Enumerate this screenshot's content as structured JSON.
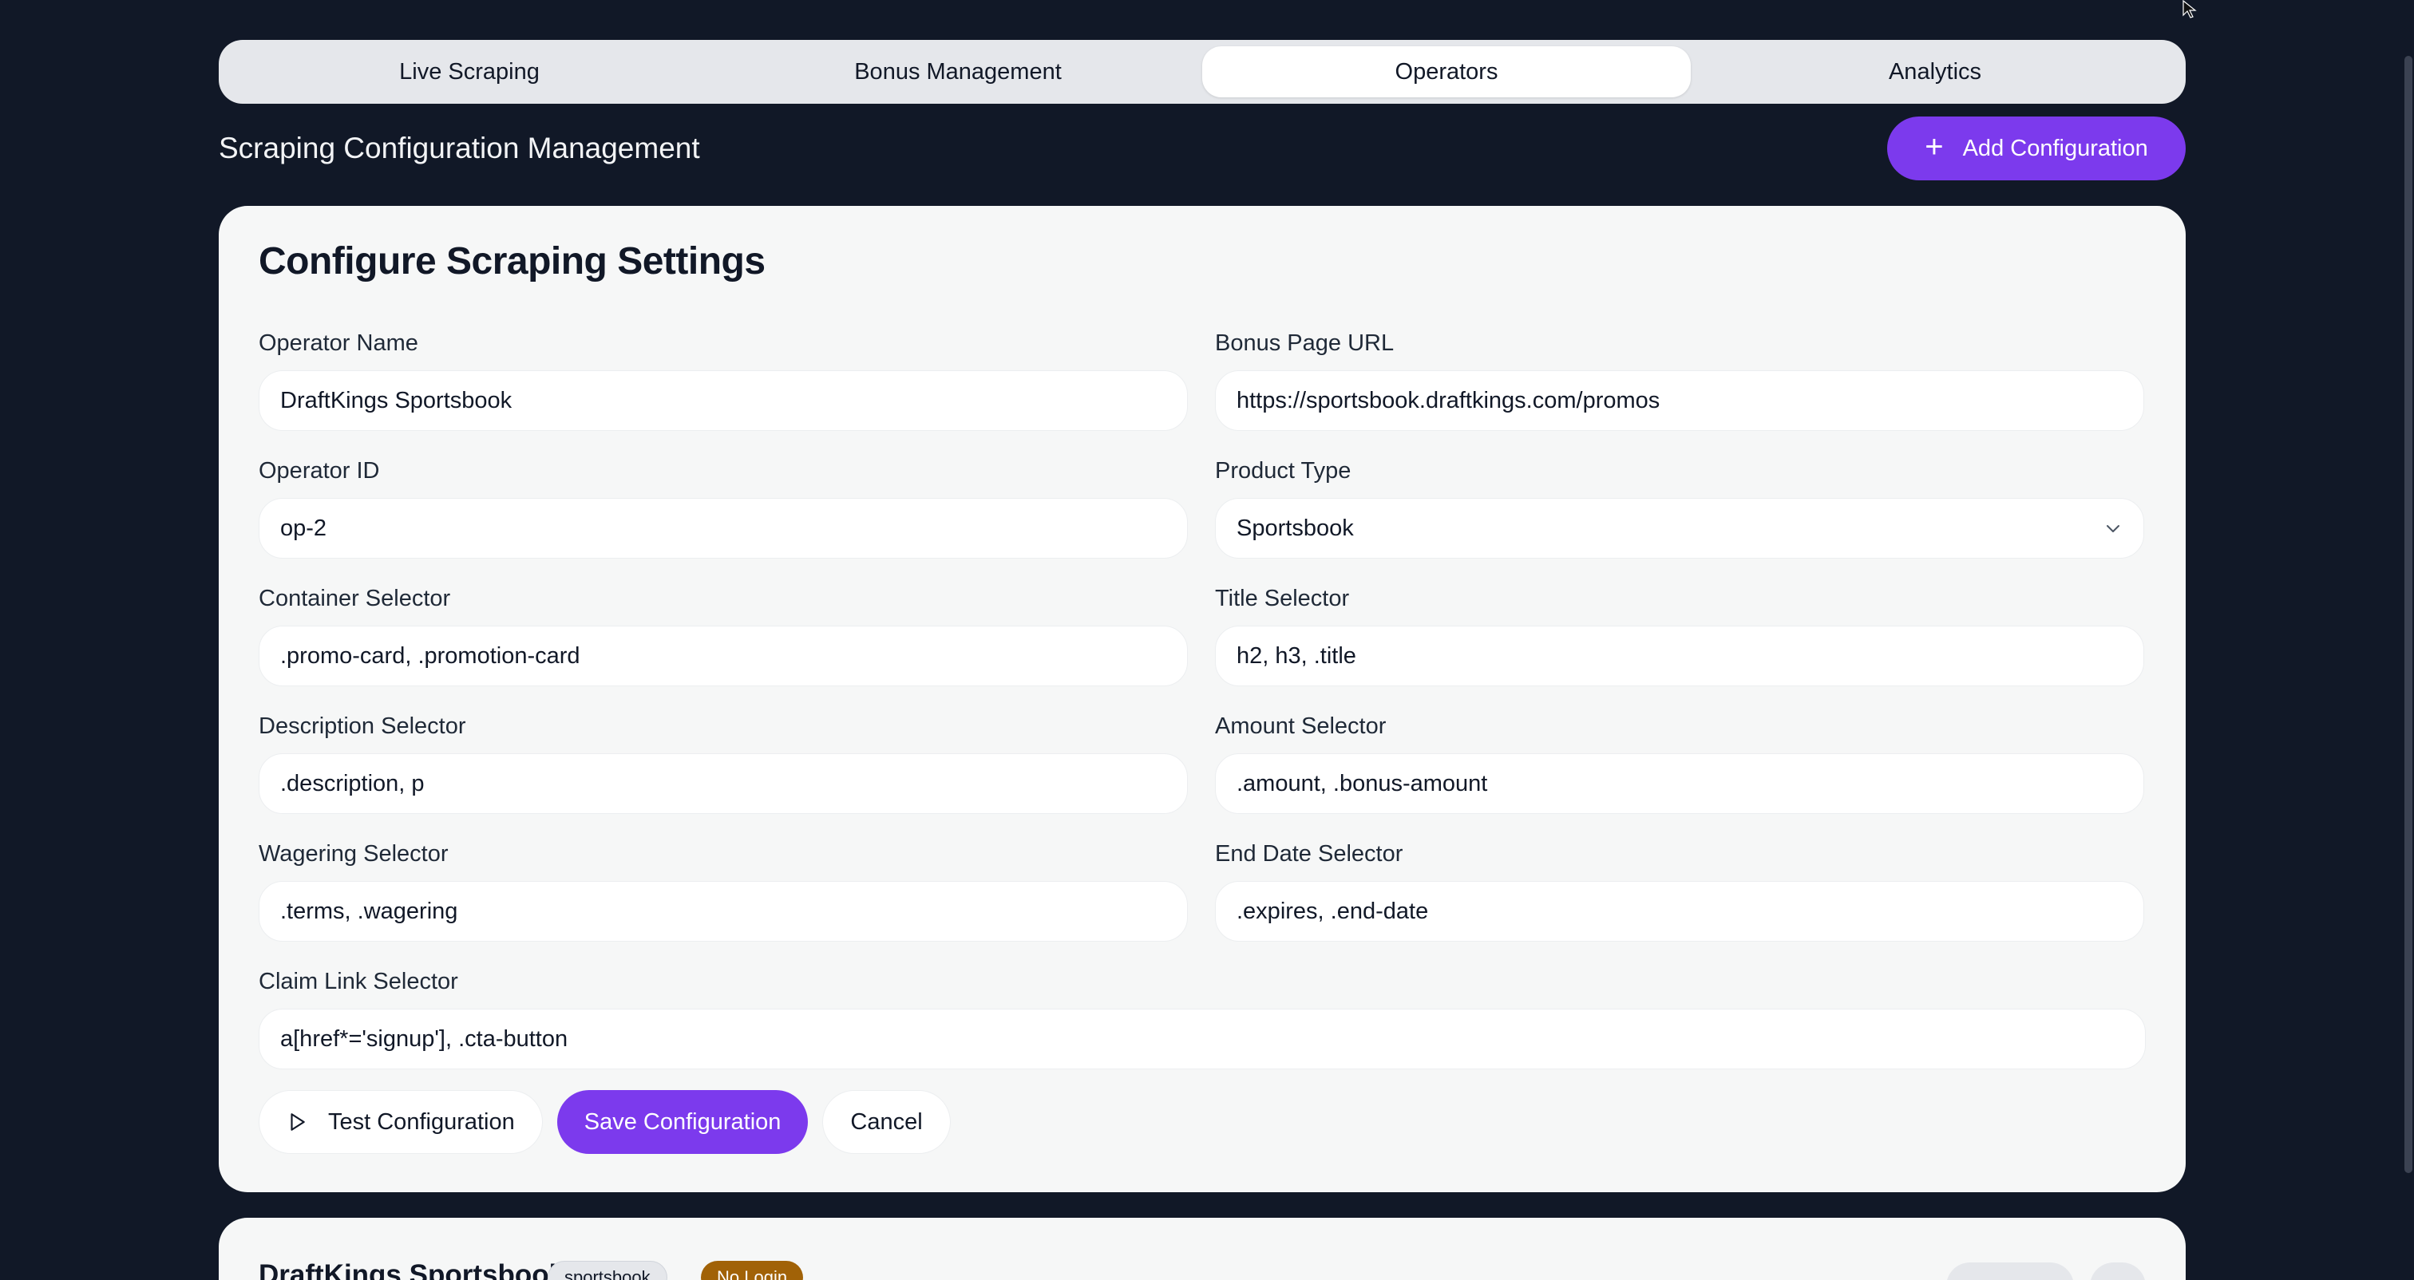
{
  "tabs": [
    {
      "label": "Live Scraping",
      "active": false
    },
    {
      "label": "Bonus Management",
      "active": false
    },
    {
      "label": "Operators",
      "active": true
    },
    {
      "label": "Analytics",
      "active": false
    }
  ],
  "header": {
    "title": "Scraping Configuration Management",
    "add_button_label": "Add Configuration"
  },
  "form": {
    "title": "Configure Scraping Settings",
    "fields": {
      "operator_name": {
        "label": "Operator Name",
        "value": "DraftKings Sportsbook"
      },
      "bonus_page_url": {
        "label": "Bonus Page URL",
        "value": "https://sportsbook.draftkings.com/promos"
      },
      "operator_id": {
        "label": "Operator ID",
        "value": "op-2"
      },
      "product_type": {
        "label": "Product Type",
        "value": "Sportsbook"
      },
      "container_selector": {
        "label": "Container Selector",
        "value": ".promo-card, .promotion-card"
      },
      "title_selector": {
        "label": "Title Selector",
        "value": "h2, h3, .title"
      },
      "description_selector": {
        "label": "Description Selector",
        "value": ".description, p"
      },
      "amount_selector": {
        "label": "Amount Selector",
        "value": ".amount, .bonus-amount"
      },
      "wagering_selector": {
        "label": "Wagering Selector",
        "value": ".terms, .wagering"
      },
      "end_date_selector": {
        "label": "End Date Selector",
        "value": ".expires, .end-date"
      },
      "claim_link_selector": {
        "label": "Claim Link Selector",
        "value": "a[href*='signup'], .cta-button"
      }
    },
    "actions": {
      "test_label": "Test Configuration",
      "save_label": "Save Configuration",
      "cancel_label": "Cancel"
    }
  },
  "operator_card": {
    "name": "DraftKings Sportsbook",
    "type_badge": "sportsbook",
    "login_badge": "No Login"
  },
  "colors": {
    "background": "#111827",
    "accent": "#7c3aed",
    "card": "#f6f7f7",
    "login_badge": "#a16207"
  },
  "icons": {
    "add": "plus-icon",
    "test": "play-icon",
    "select": "chevron-down-icon"
  }
}
